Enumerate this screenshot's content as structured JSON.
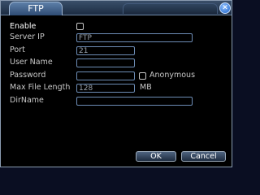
{
  "window": {
    "title": "FTP",
    "close_glyph": "✕"
  },
  "form": {
    "enable_label": "Enable",
    "server_ip_label": "Server IP",
    "server_ip_value": "FTP",
    "port_label": "Port",
    "port_value": "21",
    "user_name_label": "User Name",
    "user_name_value": "",
    "password_label": "Password",
    "password_value": "",
    "anonymous_label": "Anonymous",
    "max_file_length_label": "Max File Length",
    "max_file_length_value": "128",
    "max_file_length_unit": "MB",
    "dir_name_label": "DirName",
    "dir_name_value": ""
  },
  "buttons": {
    "ok": "OK",
    "cancel": "Cancel"
  },
  "icons": {
    "close": "close-icon"
  },
  "colors": {
    "accent": "#6d8db6",
    "title_tab": "#2f4c74"
  }
}
